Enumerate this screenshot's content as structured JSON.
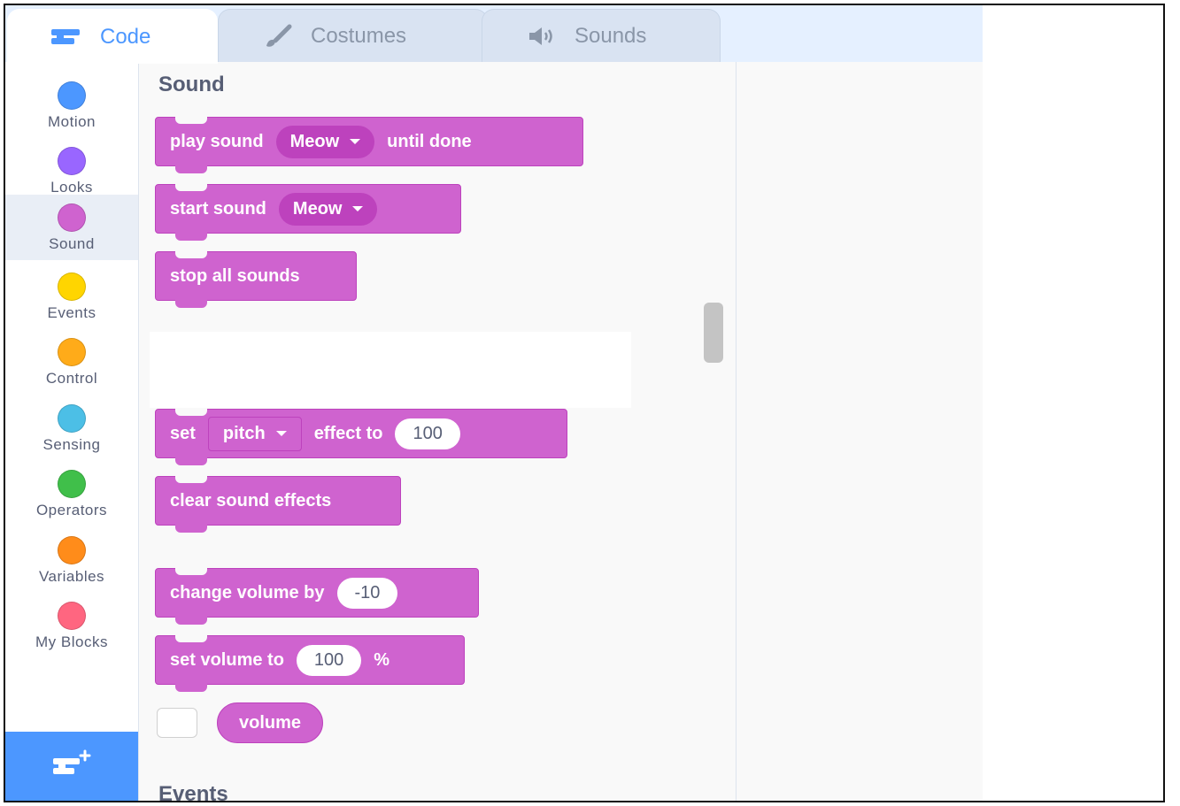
{
  "tabs": {
    "code": "Code",
    "costumes": "Costumes",
    "sounds": "Sounds"
  },
  "categories": [
    {
      "label": "Motion",
      "color": "#4c97ff"
    },
    {
      "label": "Looks",
      "color": "#9966ff"
    },
    {
      "label": "Sound",
      "color": "#cf63cf"
    },
    {
      "label": "Events",
      "color": "#ffd500"
    },
    {
      "label": "Control",
      "color": "#ffab19"
    },
    {
      "label": "Sensing",
      "color": "#4cbfe6"
    },
    {
      "label": "Operators",
      "color": "#40bf4a"
    },
    {
      "label": "Variables",
      "color": "#ff8c1a"
    },
    {
      "label": "My Blocks",
      "color": "#ff6680"
    }
  ],
  "selected_category": "Sound",
  "palette": {
    "section_sound": "Sound",
    "section_events": "Events",
    "blocks": {
      "play_sound": {
        "prefix": "play sound",
        "menu": "Meow",
        "suffix": "until done"
      },
      "start_sound": {
        "prefix": "start sound",
        "menu": "Meow"
      },
      "stop_all": {
        "label": "stop all sounds"
      },
      "set_effect": {
        "prefix": "set",
        "menu": "pitch",
        "middle": "effect to",
        "value": "100"
      },
      "clear_effects": {
        "label": "clear sound effects"
      },
      "change_volume": {
        "prefix": "change volume by",
        "value": "-10"
      },
      "set_volume": {
        "prefix": "set volume to",
        "value": "100",
        "suffix": "%"
      },
      "volume_reporter": {
        "label": "volume"
      }
    }
  },
  "colors": {
    "sound_block": "#cf63cf",
    "sound_block_border": "#bd42bd",
    "accent": "#4c97ff"
  }
}
